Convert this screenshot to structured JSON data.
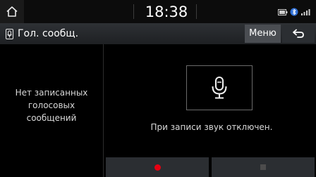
{
  "status_bar": {
    "time": "18:38",
    "home_icon": "home-icon",
    "icons": [
      "battery-icon",
      "bluetooth-icon",
      "signal-icon"
    ]
  },
  "header": {
    "title": "Гол. сообщ.",
    "title_icon": "voice-memo-icon",
    "menu_label": "Меню",
    "back_icon": "back-arrow-icon"
  },
  "left_panel": {
    "empty_message": "Нет записанных\nголосовых\nсообщений"
  },
  "main": {
    "mic_icon": "microphone-icon",
    "sound_status": "При записи звук отключен."
  },
  "controls": {
    "record_icon": "record-icon",
    "stop_icon": "stop-icon"
  },
  "colors": {
    "record": "#e60012",
    "background": "#000000",
    "button_bg": "#2b2e32",
    "menu_bg": "#4a4d52"
  }
}
